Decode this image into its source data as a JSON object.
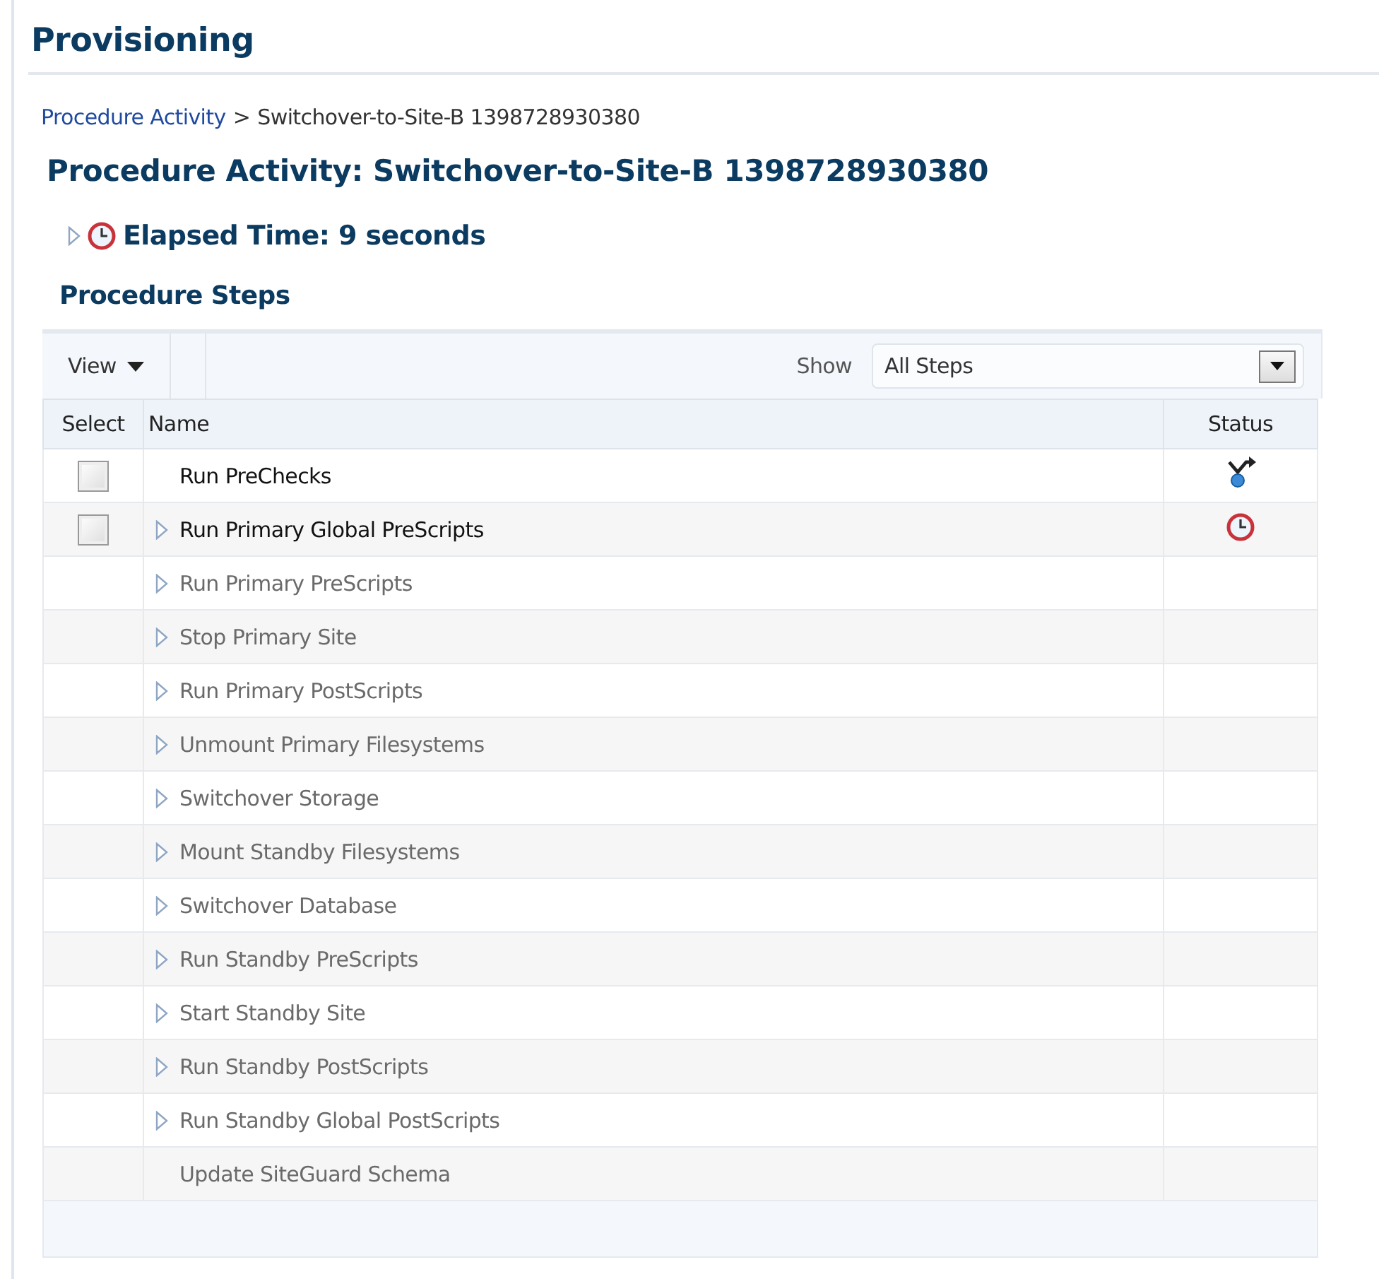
{
  "page_title": "Provisioning",
  "breadcrumb": {
    "link": "Procedure Activity",
    "separator": ">",
    "current": "Switchover-to-Site-B 1398728930380"
  },
  "heading": "Procedure Activity: Switchover-to-Site-B 1398728930380",
  "elapsed": {
    "label": "Elapsed Time: 9 seconds",
    "expanded": false
  },
  "section_title": "Procedure Steps",
  "toolbar": {
    "view_menu": "View",
    "show_label": "Show",
    "show_value": "All Steps"
  },
  "table": {
    "columns": [
      "Select",
      "Name",
      "Status"
    ],
    "rows": [
      {
        "name": "Run PreChecks",
        "checkbox": true,
        "checked": false,
        "expandable": false,
        "enabled": true,
        "status": {
          "kind": "fork"
        }
      },
      {
        "name": "Run Primary Global PreScripts",
        "checkbox": true,
        "checked": false,
        "expandable": true,
        "enabled": true,
        "status": {
          "kind": "clock"
        }
      },
      {
        "name": "Run Primary PreScripts",
        "checkbox": false,
        "expandable": true,
        "enabled": false
      },
      {
        "name": "Stop Primary Site",
        "checkbox": false,
        "expandable": true,
        "enabled": false
      },
      {
        "name": "Run Primary PostScripts",
        "checkbox": false,
        "expandable": true,
        "enabled": false
      },
      {
        "name": "Unmount Primary Filesystems",
        "checkbox": false,
        "expandable": true,
        "enabled": false
      },
      {
        "name": "Switchover Storage",
        "checkbox": false,
        "expandable": true,
        "enabled": false
      },
      {
        "name": "Mount Standby Filesystems",
        "checkbox": false,
        "expandable": true,
        "enabled": false
      },
      {
        "name": "Switchover Database",
        "checkbox": false,
        "expandable": true,
        "enabled": false
      },
      {
        "name": "Run Standby PreScripts",
        "checkbox": false,
        "expandable": true,
        "enabled": false
      },
      {
        "name": "Start Standby Site",
        "checkbox": false,
        "expandable": true,
        "enabled": false
      },
      {
        "name": "Run Standby PostScripts",
        "checkbox": false,
        "expandable": true,
        "enabled": false
      },
      {
        "name": "Run Standby Global PostScripts",
        "checkbox": false,
        "expandable": true,
        "enabled": false
      },
      {
        "name": "Update SiteGuard Schema",
        "checkbox": false,
        "expandable": false,
        "enabled": false
      }
    ]
  }
}
